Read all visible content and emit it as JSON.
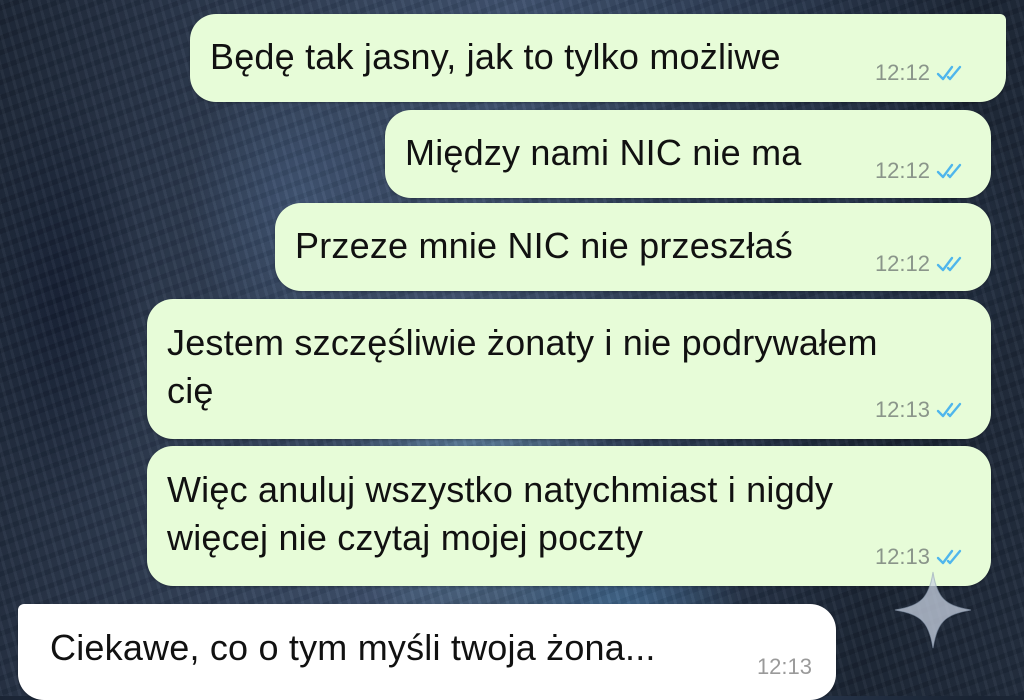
{
  "chat": {
    "messages": [
      {
        "direction": "outgoing",
        "text_lines": [
          "Będę tak jasny, jak to tylko możliwe"
        ],
        "time": "12:12",
        "status": "read"
      },
      {
        "direction": "outgoing",
        "text_lines": [
          "Między nami NIC nie ma"
        ],
        "time": "12:12",
        "status": "read"
      },
      {
        "direction": "outgoing",
        "text_lines": [
          "Przeze mnie NIC nie przeszłaś"
        ],
        "time": "12:12",
        "status": "read"
      },
      {
        "direction": "outgoing",
        "text_lines": [
          "Jestem szczęśliwie żonaty i nie podrywałem",
          "cię"
        ],
        "time": "12:13",
        "status": "read"
      },
      {
        "direction": "outgoing",
        "text_lines": [
          "Więc anuluj wszystko natychmiast i nigdy",
          "więcej nie czytaj mojej poczty"
        ],
        "time": "12:13",
        "status": "read"
      },
      {
        "direction": "incoming",
        "text_lines": [
          "Ciekawe, co o tym myśli twoja żona..."
        ],
        "time": "12:13"
      }
    ]
  },
  "colors": {
    "outgoing_bubble": "#e7fcd8",
    "incoming_bubble": "#ffffff",
    "read_ticks": "#4fb6ec"
  },
  "icons": {
    "read_receipt": "double-check-icon",
    "overlay": "sparkle-icon"
  }
}
